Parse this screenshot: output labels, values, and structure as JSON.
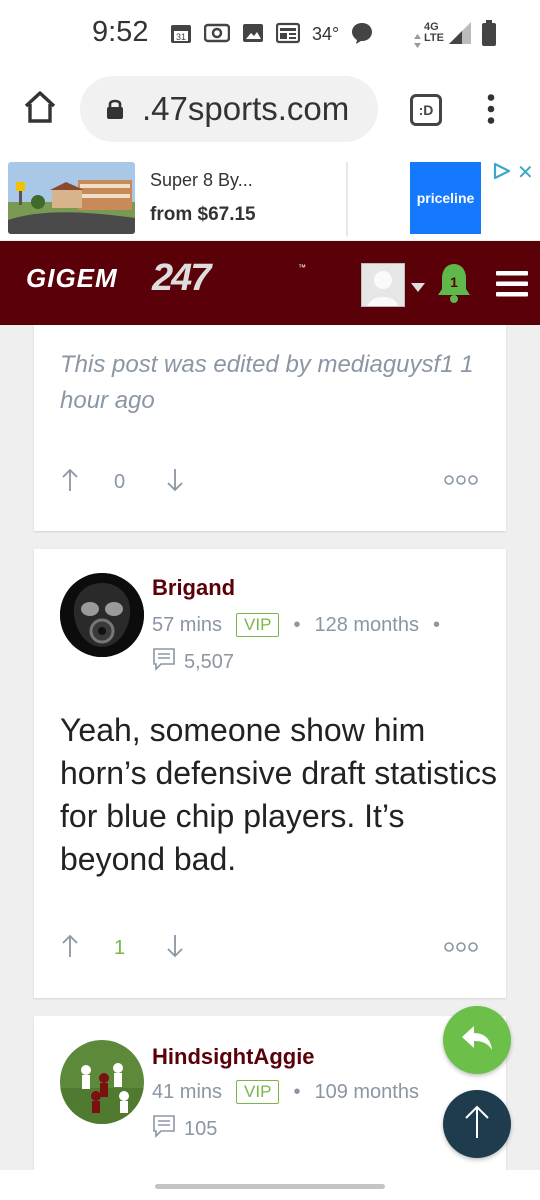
{
  "status_bar": {
    "time": "9:52",
    "calendar_day": "31",
    "temperature": "34°",
    "network_top": "4G",
    "network_bottom": "LTE",
    "icons": [
      "calendar-icon",
      "radio-icon",
      "image-icon",
      "news-icon",
      "message-icon",
      "signal-icon",
      "battery-icon"
    ]
  },
  "browser": {
    "url": ".47sports.com",
    "tabs_label": ":D",
    "icons": [
      "home-icon",
      "lock-icon",
      "menu-dots-icon"
    ]
  },
  "ad": {
    "title": "Super 8 By...",
    "price": "from $67.15",
    "brand": "priceline",
    "close": "✕"
  },
  "site_header": {
    "logo_text": "GIGEM",
    "logo_number": "247",
    "logo_tm": "™",
    "notification_count": "1",
    "icons": [
      "avatar-placeholder",
      "caret-down-icon",
      "bell-icon",
      "hamburger-icon"
    ]
  },
  "posts": [
    {
      "edited_note": "This post was edited by mediaguysf1 1 hour ago",
      "votes": "0",
      "vote_color": "#8b96a4"
    },
    {
      "author": "Brigand",
      "time": "57 mins",
      "badge": "VIP",
      "tenure": "128 months",
      "post_count": "5,507",
      "body": "Yeah, someone show him horn’s defensive draft statistics for blue chip players. It’s beyond bad.",
      "votes": "1",
      "vote_color": "#7ab648"
    },
    {
      "author": "HindsightAggie",
      "time": "41 mins",
      "badge": "VIP",
      "tenure": "109 months",
      "post_count": "105"
    }
  ],
  "separator": "•",
  "colors": {
    "brand": "#5a0008",
    "muted": "#8b96a4",
    "vip": "#7ab648",
    "reply_fab": "#6cc04a",
    "top_fab": "#1f3c4f"
  }
}
